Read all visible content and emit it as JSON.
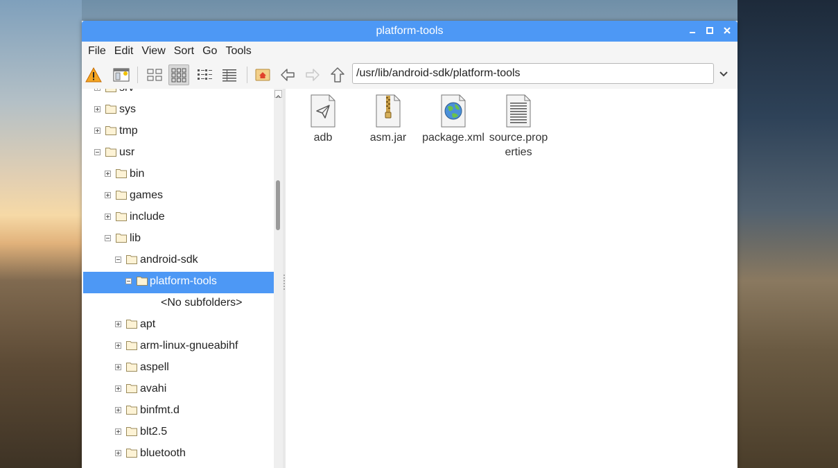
{
  "window": {
    "title": "platform-tools"
  },
  "menu": [
    "File",
    "Edit",
    "View",
    "Sort",
    "Go",
    "Tools"
  ],
  "toolbar": {
    "path": "/usr/lib/android-sdk/platform-tools",
    "buttons": [
      "warning-icon",
      "new-window-icon",
      "icon-view-icon",
      "thumbnail-view-icon",
      "compact-view-icon",
      "list-view-icon",
      "home-icon",
      "back-icon",
      "forward-icon",
      "up-icon"
    ],
    "active_view": "thumbnail-view-icon"
  },
  "tree": {
    "items": [
      {
        "label": "srv",
        "expanded": false
      },
      {
        "label": "sys",
        "expanded": false
      },
      {
        "label": "tmp",
        "expanded": false
      },
      {
        "label": "usr",
        "expanded": true
      },
      {
        "label": "bin",
        "expanded": false
      },
      {
        "label": "games",
        "expanded": false
      },
      {
        "label": "include",
        "expanded": false
      },
      {
        "label": "lib",
        "expanded": true
      },
      {
        "label": "android-sdk",
        "expanded": true
      },
      {
        "label": "platform-tools",
        "expanded": true,
        "selected": true
      },
      {
        "label": "<No subfolders>"
      },
      {
        "label": "apt",
        "expanded": false
      },
      {
        "label": "arm-linux-gnueabihf",
        "expanded": false
      },
      {
        "label": "aspell",
        "expanded": false
      },
      {
        "label": "avahi",
        "expanded": false
      },
      {
        "label": "binfmt.d",
        "expanded": false
      },
      {
        "label": "blt2.5",
        "expanded": false
      },
      {
        "label": "bluetooth",
        "expanded": false
      }
    ]
  },
  "files": [
    {
      "name": "adb",
      "icon": "executable-icon"
    },
    {
      "name": "asm.jar",
      "icon": "archive-icon"
    },
    {
      "name": "package.xml",
      "icon": "xml-document-icon"
    },
    {
      "name": "source.properties",
      "icon": "text-document-icon"
    }
  ],
  "colors": {
    "accent": "#4d98f5",
    "selection": "#4d98f5"
  }
}
